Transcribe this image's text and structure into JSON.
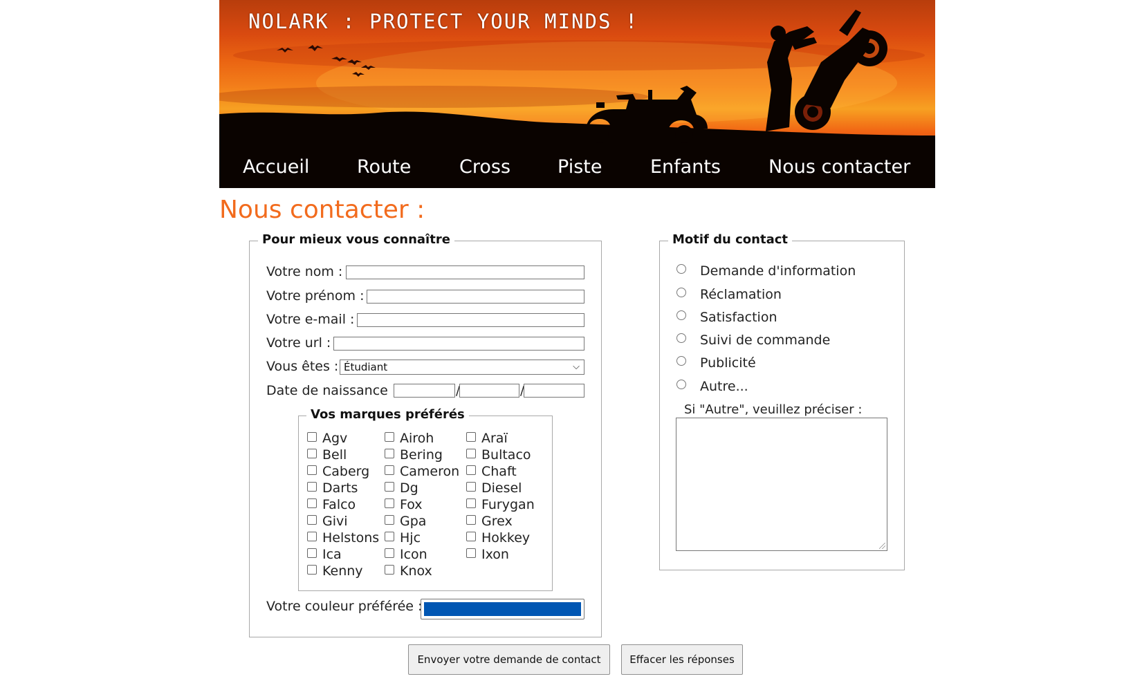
{
  "header": {
    "site_title": "NOLARK : PROTECT YOUR MINDS !",
    "nav": [
      "Accueil",
      "Route",
      "Cross",
      "Piste",
      "Enfants",
      "Nous contacter"
    ]
  },
  "page": {
    "heading": "Nous contacter :"
  },
  "profile": {
    "legend": "Pour mieux vous connaître",
    "name_label": "Votre nom :",
    "firstname_label": "Votre prénom :",
    "email_label": "Votre e-mail :",
    "url_label": "Votre url :",
    "status_label": "Vous êtes :",
    "status_value": "Étudiant",
    "birthdate_label": "Date de naissance :",
    "birthdate_separator": "/",
    "brands": {
      "legend": "Vos marques préférés",
      "col1": [
        "Agv",
        "Bell",
        "Caberg",
        "Darts",
        "Falco",
        "Givi",
        "Helstons",
        "Ica",
        "Kenny"
      ],
      "col2": [
        "Airoh",
        "Bering",
        "Cameron",
        "Dg",
        "Fox",
        "Gpa",
        "Hjc",
        "Icon",
        "Knox"
      ],
      "col3": [
        "Araï",
        "Bultaco",
        "Chaft",
        "Diesel",
        "Furygan",
        "Grex",
        "Hokkey",
        "Ixon"
      ]
    },
    "color_label": "Votre couleur préférée :",
    "color_value": "#0056b3"
  },
  "reason": {
    "legend": "Motif du contact",
    "options": [
      "Demande d'information",
      "Réclamation",
      "Satisfaction",
      "Suivi de commande",
      "Publicité",
      "Autre..."
    ],
    "other_label": "Si \"Autre\", veuillez préciser :"
  },
  "buttons": {
    "submit": "Envoyer votre demande de contact",
    "reset": "Effacer les réponses"
  },
  "colors": {
    "accent": "#f26b1d",
    "banner_dark": "#000000"
  },
  "icons": {
    "select_arrow": "chevron-down-icon"
  }
}
